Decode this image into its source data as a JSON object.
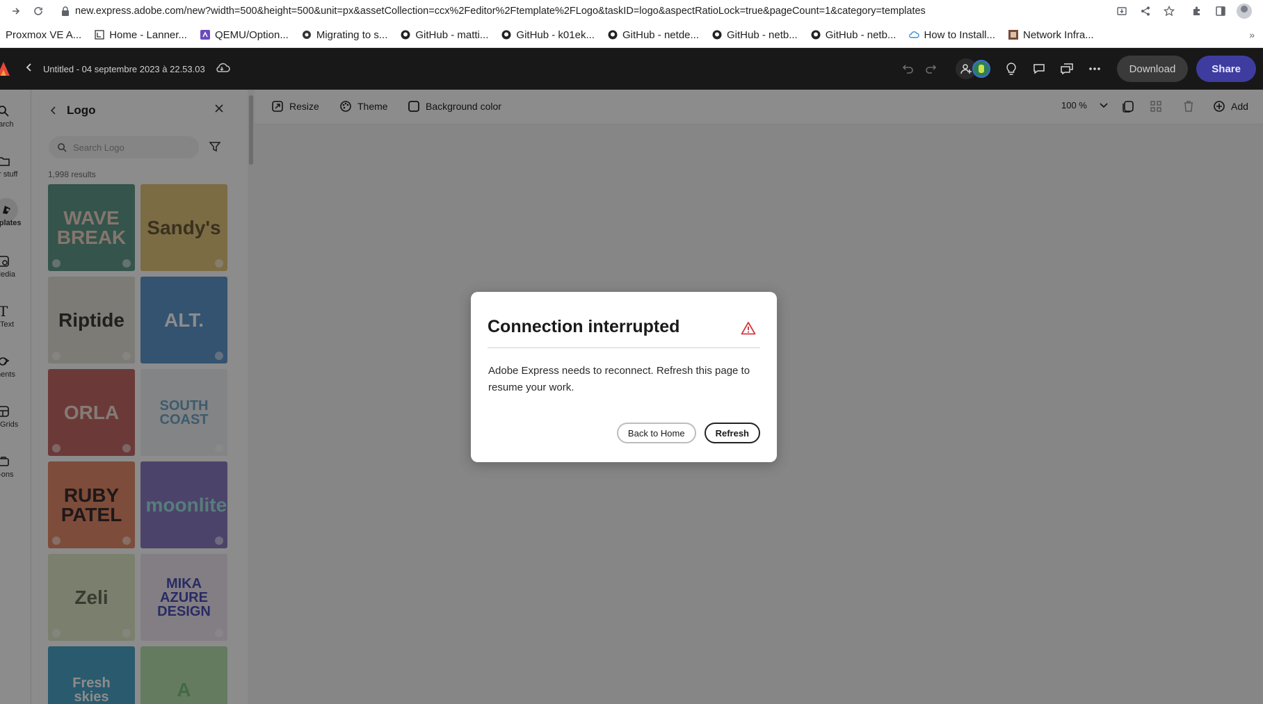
{
  "browser": {
    "url": "new.express.adobe.com/new?width=500&height=500&unit=px&assetCollection=ccx%2Feditor%2Ftemplate%2FLogo&taskID=logo&aspectRatioLock=true&pageCount=1&category=templates",
    "bookmarks": [
      {
        "label": "Proxmox VE A...",
        "icon": "proxmox-icon"
      },
      {
        "label": "Home - Lanner...",
        "icon": "page-icon"
      },
      {
        "label": "QEMU/Option...",
        "icon": "qemu-icon"
      },
      {
        "label": "Migrating to s...",
        "icon": "circle-icon"
      },
      {
        "label": "GitHub - matti...",
        "icon": "github-icon"
      },
      {
        "label": "GitHub - k01ek...",
        "icon": "github-icon"
      },
      {
        "label": "GitHub - netde...",
        "icon": "github-icon"
      },
      {
        "label": "GitHub - netb...",
        "icon": "github-icon"
      },
      {
        "label": "GitHub - netb...",
        "icon": "github-icon"
      },
      {
        "label": "How to Install...",
        "icon": "cloud-icon"
      },
      {
        "label": "Network Infra...",
        "icon": "site-icon"
      }
    ],
    "more": "»"
  },
  "header": {
    "doc_title": "Untitled - 04 septembre 2023 à 22.53.03",
    "download_label": "Download",
    "share_label": "Share"
  },
  "rail": {
    "items": [
      {
        "label": "earch",
        "icon": "search-icon"
      },
      {
        "label": "ur stuff",
        "icon": "folder-icon"
      },
      {
        "label": "nplates",
        "icon": "templates-icon"
      },
      {
        "label": "Media",
        "icon": "media-icon"
      },
      {
        "label": "Text",
        "icon": "text-icon"
      },
      {
        "label": "ments",
        "icon": "elements-icon"
      },
      {
        "label": "Grids",
        "icon": "grid-icon"
      },
      {
        "label": "d-ons",
        "icon": "addons-icon"
      }
    ]
  },
  "panel": {
    "title": "Logo",
    "search_placeholder": "Search Logo",
    "results": "1,998 results",
    "tiles": [
      {
        "text": "WAVE BREAK",
        "bg": "#5f9a8b",
        "fg": "#f2d7c9"
      },
      {
        "text": "Sandy's",
        "bg": "#e2c57d",
        "fg": "#6b5a3a"
      },
      {
        "text": "Riptide",
        "bg": "#e4e0d6",
        "fg": "#3a3a3a"
      },
      {
        "text": "ALT.",
        "bg": "#5d97cc",
        "fg": "#ffffff"
      },
      {
        "text": "ORLA",
        "bg": "#c46a66",
        "fg": "#f3e0d6"
      },
      {
        "text": "SOUTH COAST",
        "bg": "#eef1f3",
        "fg": "#6fa6c6"
      },
      {
        "text": "RUBY PATEL",
        "bg": "#e48b6a",
        "fg": "#3a2c2c"
      },
      {
        "text": "moonlite",
        "bg": "#8a7ac4",
        "fg": "#9fe3e0"
      },
      {
        "text": "Zeli",
        "bg": "#dfe8c8",
        "fg": "#6a6a5a"
      },
      {
        "text": "MIKA AZURE DESIGN",
        "bg": "#efe6ee",
        "fg": "#4a4fb6"
      },
      {
        "text": "Fresh skies",
        "bg": "#4ea5c7",
        "fg": "#ffffff"
      },
      {
        "text": "A",
        "bg": "#b6e0b0",
        "fg": "#7cbf7a"
      }
    ]
  },
  "toolbar": {
    "resize": "Resize",
    "theme": "Theme",
    "background": "Background color",
    "zoom": "100 %",
    "add": "Add"
  },
  "dialog": {
    "title": "Connection interrupted",
    "body": "Adobe Express needs to reconnect. Refresh this page to resume your work.",
    "back_label": "Back to Home",
    "refresh_label": "Refresh",
    "alert_color": "#d7373f"
  }
}
